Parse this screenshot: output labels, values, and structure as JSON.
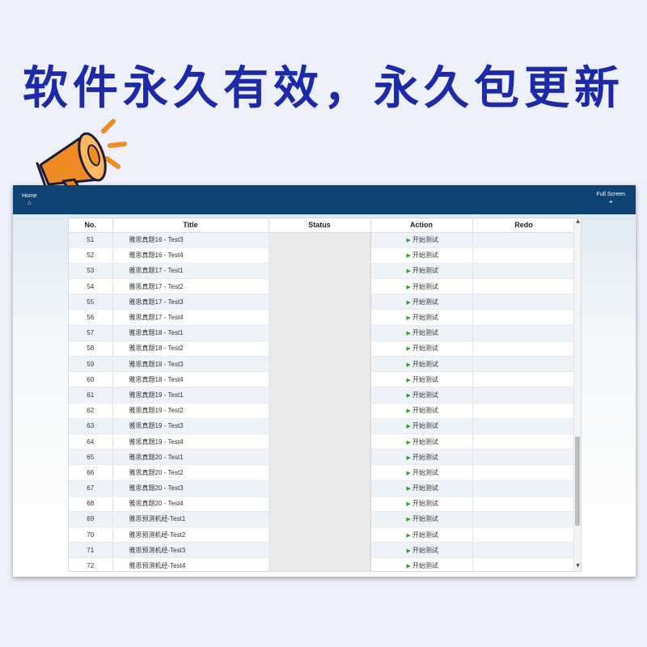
{
  "banner": {
    "headline": "软件永久有效，永久包更新"
  },
  "app": {
    "home_label": "Home",
    "fullscreen_label": "Full Screen"
  },
  "table": {
    "columns": [
      "No.",
      "Title",
      "Status",
      "Action",
      "Redo"
    ],
    "action_label": "开始测试",
    "rows": [
      {
        "no": "51",
        "title": "雅思真题16 - Test3"
      },
      {
        "no": "52",
        "title": "雅思真题16 - Test4"
      },
      {
        "no": "53",
        "title": "雅思真题17 - Test1"
      },
      {
        "no": "54",
        "title": "雅思真题17 - Test2"
      },
      {
        "no": "55",
        "title": "雅思真题17 - Test3"
      },
      {
        "no": "56",
        "title": "雅思真题17 - Test4"
      },
      {
        "no": "57",
        "title": "雅思真题18 - Test1"
      },
      {
        "no": "58",
        "title": "雅思真题18 - Test2"
      },
      {
        "no": "59",
        "title": "雅思真题18 - Test3"
      },
      {
        "no": "60",
        "title": "雅思真题18 - Test4"
      },
      {
        "no": "61",
        "title": "雅思真题19 - Test1"
      },
      {
        "no": "62",
        "title": "雅思真题19 - Test2"
      },
      {
        "no": "63",
        "title": "雅思真题19 - Test3"
      },
      {
        "no": "64",
        "title": "雅思真题19 - Test4"
      },
      {
        "no": "65",
        "title": "雅思真题20 - Test1"
      },
      {
        "no": "66",
        "title": "雅思真题20 - Test2"
      },
      {
        "no": "67",
        "title": "雅思真题20 - Test3"
      },
      {
        "no": "68",
        "title": "雅思真题20 - Test4"
      },
      {
        "no": "69",
        "title": "雅思预测机经-Test1"
      },
      {
        "no": "70",
        "title": "雅思预测机经-Test2"
      },
      {
        "no": "71",
        "title": "雅思预测机经-Test3"
      },
      {
        "no": "72",
        "title": "雅思预测机经-Test4"
      }
    ]
  },
  "icons": {
    "home": "house-icon",
    "fullscreen": "expand-icon",
    "play": "play-triangle-icon",
    "megaphone": "megaphone-icon"
  },
  "colors": {
    "headline": "#1c2aa8",
    "topbar": "#0e4272",
    "megaphone": "#f08a22",
    "play": "#2ba32b",
    "row_alt": "#eef3fa"
  }
}
